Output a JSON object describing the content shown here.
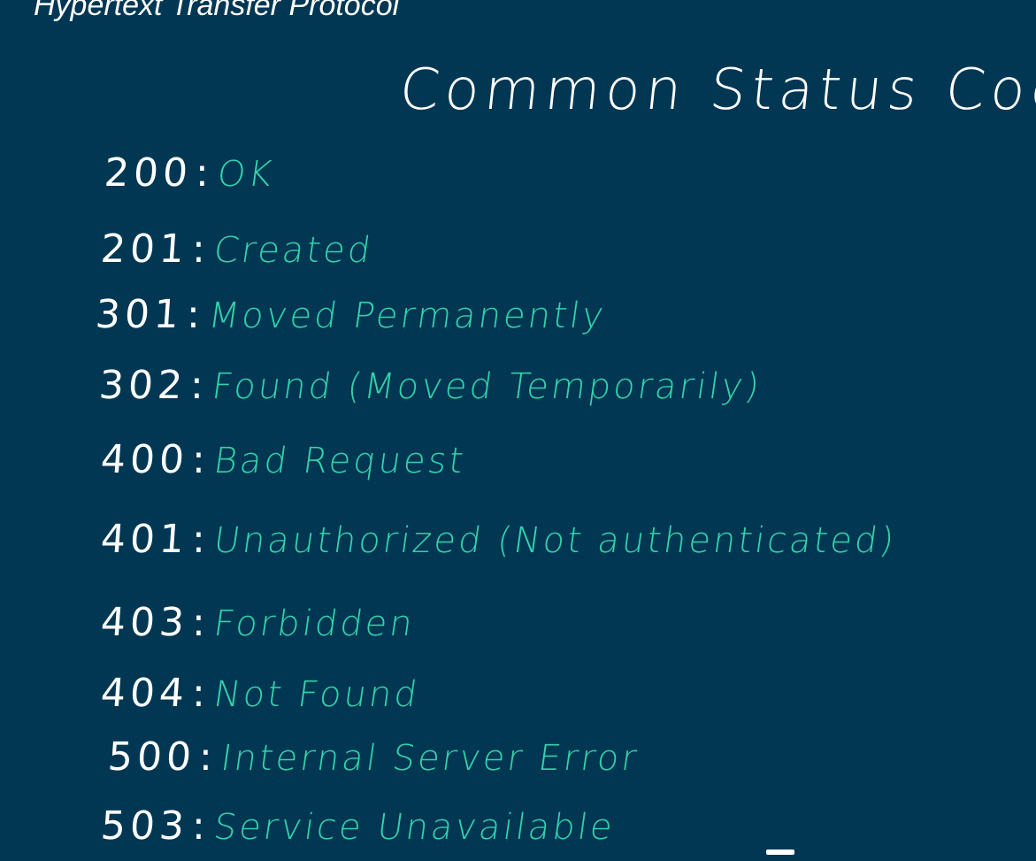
{
  "header": {
    "title": "Hypertext Transfer Protocol"
  },
  "board": {
    "title": "Common Status Codes",
    "separator": ":",
    "status_codes": [
      {
        "code": "200",
        "description": "OK"
      },
      {
        "code": "201",
        "description": "Created"
      },
      {
        "code": "301",
        "description": "Moved Permanently"
      },
      {
        "code": "302",
        "description": "Found (Moved Temporarily)"
      },
      {
        "code": "400",
        "description": "Bad Request"
      },
      {
        "code": "401",
        "description": "Unauthorized (Not authenticated)"
      },
      {
        "code": "403",
        "description": "Forbidden"
      },
      {
        "code": "404",
        "description": "Not Found"
      },
      {
        "code": "500",
        "description": "Internal Server Error"
      },
      {
        "code": "503",
        "description": "Service Unavailable"
      }
    ]
  },
  "colors": {
    "background": "#013753",
    "code_text": "#ffffff",
    "description_text": "#33d2ab"
  }
}
